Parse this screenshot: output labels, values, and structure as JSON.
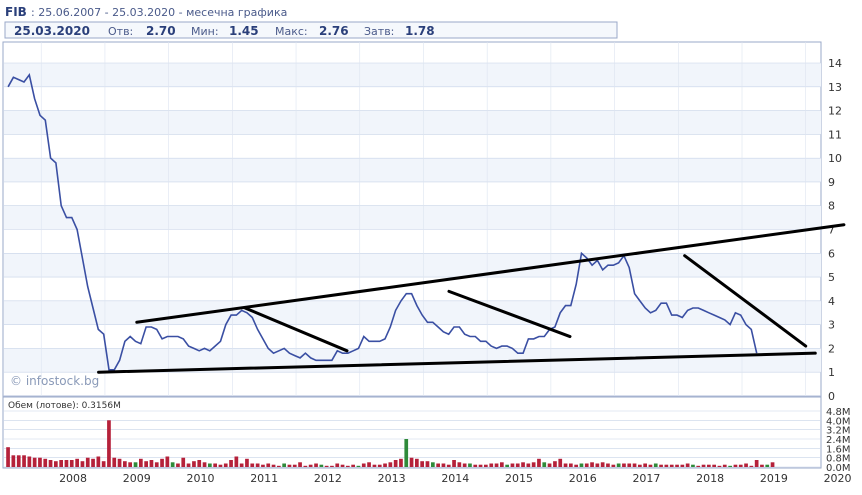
{
  "header": {
    "symbol": "FIB",
    "period": ": 25.06.2007 - 25.03.2020 - месечна графика",
    "date": "25.03.2020",
    "open_label": "Отв:",
    "open_value": "2.70",
    "min_label": "Мин:",
    "min_value": "1.45",
    "max_label": "Макс:",
    "max_value": "2.76",
    "close_label": "Затв:",
    "close_value": "1.78"
  },
  "watermark": "© infostock.bg",
  "volume_label": "Обем (лотове): 0.3156M",
  "colors": {
    "price_line": "#3a4fa3",
    "trend_line": "#000000",
    "volume_default": "#b5213a",
    "volume_high": "#2f8a3a",
    "grid": "#c8d4e8",
    "plot_bg": "#f1f5fb",
    "header_text": "#2a3f7a"
  },
  "chart_data": [
    {
      "type": "line",
      "name": "price",
      "x_start": "2007.48",
      "x_step_months": 1,
      "x_tick_labels": [
        "2008",
        "2009",
        "2010",
        "2011",
        "2012",
        "2013",
        "2014",
        "2015",
        "2016",
        "2017",
        "2018",
        "2019",
        "2020"
      ],
      "y_ticks": [
        0,
        1,
        2,
        3,
        4,
        5,
        6,
        7,
        8,
        9,
        10,
        11,
        12,
        13,
        14
      ],
      "ylim": [
        0,
        14.5
      ],
      "xlim": [
        2007.4,
        2020.24
      ],
      "grid": true,
      "values": [
        13.0,
        13.4,
        13.3,
        13.2,
        13.5,
        12.5,
        11.8,
        11.6,
        10.0,
        9.8,
        8.0,
        7.5,
        7.5,
        7.0,
        5.8,
        4.6,
        3.7,
        2.8,
        2.6,
        1.1,
        1.1,
        1.5,
        2.3,
        2.5,
        2.3,
        2.2,
        2.9,
        2.9,
        2.8,
        2.4,
        2.5,
        2.5,
        2.5,
        2.4,
        2.1,
        2.0,
        1.9,
        2.0,
        1.9,
        2.1,
        2.3,
        3.0,
        3.4,
        3.4,
        3.6,
        3.5,
        3.3,
        2.8,
        2.4,
        2.0,
        1.8,
        1.9,
        2.0,
        1.8,
        1.7,
        1.6,
        1.8,
        1.6,
        1.5,
        1.5,
        1.5,
        1.5,
        1.9,
        1.8,
        1.8,
        1.9,
        2.0,
        2.5,
        2.3,
        2.3,
        2.3,
        2.4,
        2.9,
        3.6,
        4.0,
        4.3,
        4.3,
        3.8,
        3.4,
        3.1,
        3.1,
        2.9,
        2.7,
        2.6,
        2.9,
        2.9,
        2.6,
        2.5,
        2.5,
        2.3,
        2.3,
        2.1,
        2.0,
        2.1,
        2.1,
        2.0,
        1.8,
        1.8,
        2.4,
        2.4,
        2.5,
        2.5,
        2.8,
        2.9,
        3.5,
        3.8,
        3.8,
        4.7,
        6.0,
        5.8,
        5.5,
        5.7,
        5.3,
        5.5,
        5.5,
        5.6,
        5.9,
        5.4,
        4.3,
        4.0,
        3.7,
        3.5,
        3.6,
        3.9,
        3.9,
        3.4,
        3.4,
        3.3,
        3.6,
        3.7,
        3.7,
        3.6,
        3.5,
        3.4,
        3.3,
        3.2,
        3.0,
        3.5,
        3.4,
        3.0,
        2.8,
        1.8
      ]
    },
    {
      "type": "line",
      "name": "trendlines",
      "segments": [
        {
          "x": [
            2009.5,
            2020.6
          ],
          "y": [
            3.1,
            7.2
          ]
        },
        {
          "x": [
            2008.9,
            2020.15
          ],
          "y": [
            1.0,
            1.8
          ]
        },
        {
          "x": [
            2011.2,
            2012.8
          ],
          "y": [
            3.7,
            1.9
          ]
        },
        {
          "x": [
            2014.4,
            2016.3
          ],
          "y": [
            4.4,
            2.5
          ]
        },
        {
          "x": [
            2018.1,
            2020.0
          ],
          "y": [
            5.9,
            2.1
          ]
        }
      ]
    },
    {
      "type": "bar",
      "name": "volume",
      "ylim": [
        0,
        4.8
      ],
      "y_ticks": [
        0,
        0.8,
        1.6,
        2.4,
        3.2,
        4.0,
        4.8
      ],
      "y_tick_labels": [
        "0.0M",
        "0.8M",
        "1.6M",
        "2.4M",
        "3.2M",
        "4.0M",
        "4.8M"
      ],
      "values": [
        1.7,
        1.0,
        1.0,
        1.0,
        0.9,
        0.8,
        0.8,
        0.7,
        0.6,
        0.5,
        0.6,
        0.6,
        0.6,
        0.7,
        0.5,
        0.8,
        0.7,
        0.9,
        0.5,
        4.0,
        0.8,
        0.7,
        0.5,
        0.4,
        0.4,
        0.7,
        0.5,
        0.6,
        0.4,
        0.7,
        0.9,
        0.4,
        0.3,
        0.8,
        0.3,
        0.5,
        0.6,
        0.4,
        0.3,
        0.3,
        0.2,
        0.3,
        0.6,
        0.9,
        0.3,
        0.7,
        0.3,
        0.3,
        0.2,
        0.3,
        0.2,
        0.1,
        0.3,
        0.2,
        0.2,
        0.4,
        0.1,
        0.2,
        0.3,
        0.2,
        0.1,
        0.1,
        0.3,
        0.2,
        0.1,
        0.2,
        0.1,
        0.3,
        0.4,
        0.2,
        0.2,
        0.3,
        0.4,
        0.6,
        0.7,
        2.4,
        0.8,
        0.7,
        0.5,
        0.5,
        0.4,
        0.3,
        0.3,
        0.2,
        0.6,
        0.4,
        0.3,
        0.3,
        0.2,
        0.2,
        0.2,
        0.3,
        0.3,
        0.4,
        0.2,
        0.3,
        0.3,
        0.4,
        0.3,
        0.4,
        0.7,
        0.4,
        0.3,
        0.5,
        0.7,
        0.3,
        0.3,
        0.2,
        0.3,
        0.3,
        0.4,
        0.3,
        0.4,
        0.3,
        0.2,
        0.3,
        0.3,
        0.3,
        0.3,
        0.2,
        0.3,
        0.2,
        0.3,
        0.2,
        0.2,
        0.2,
        0.2,
        0.2,
        0.3,
        0.2,
        0.1,
        0.2,
        0.2,
        0.2,
        0.1,
        0.2,
        0.1,
        0.2,
        0.2,
        0.3,
        0.1,
        0.6,
        0.2,
        0.2,
        0.4
      ],
      "high_threshold": 2.0
    }
  ]
}
